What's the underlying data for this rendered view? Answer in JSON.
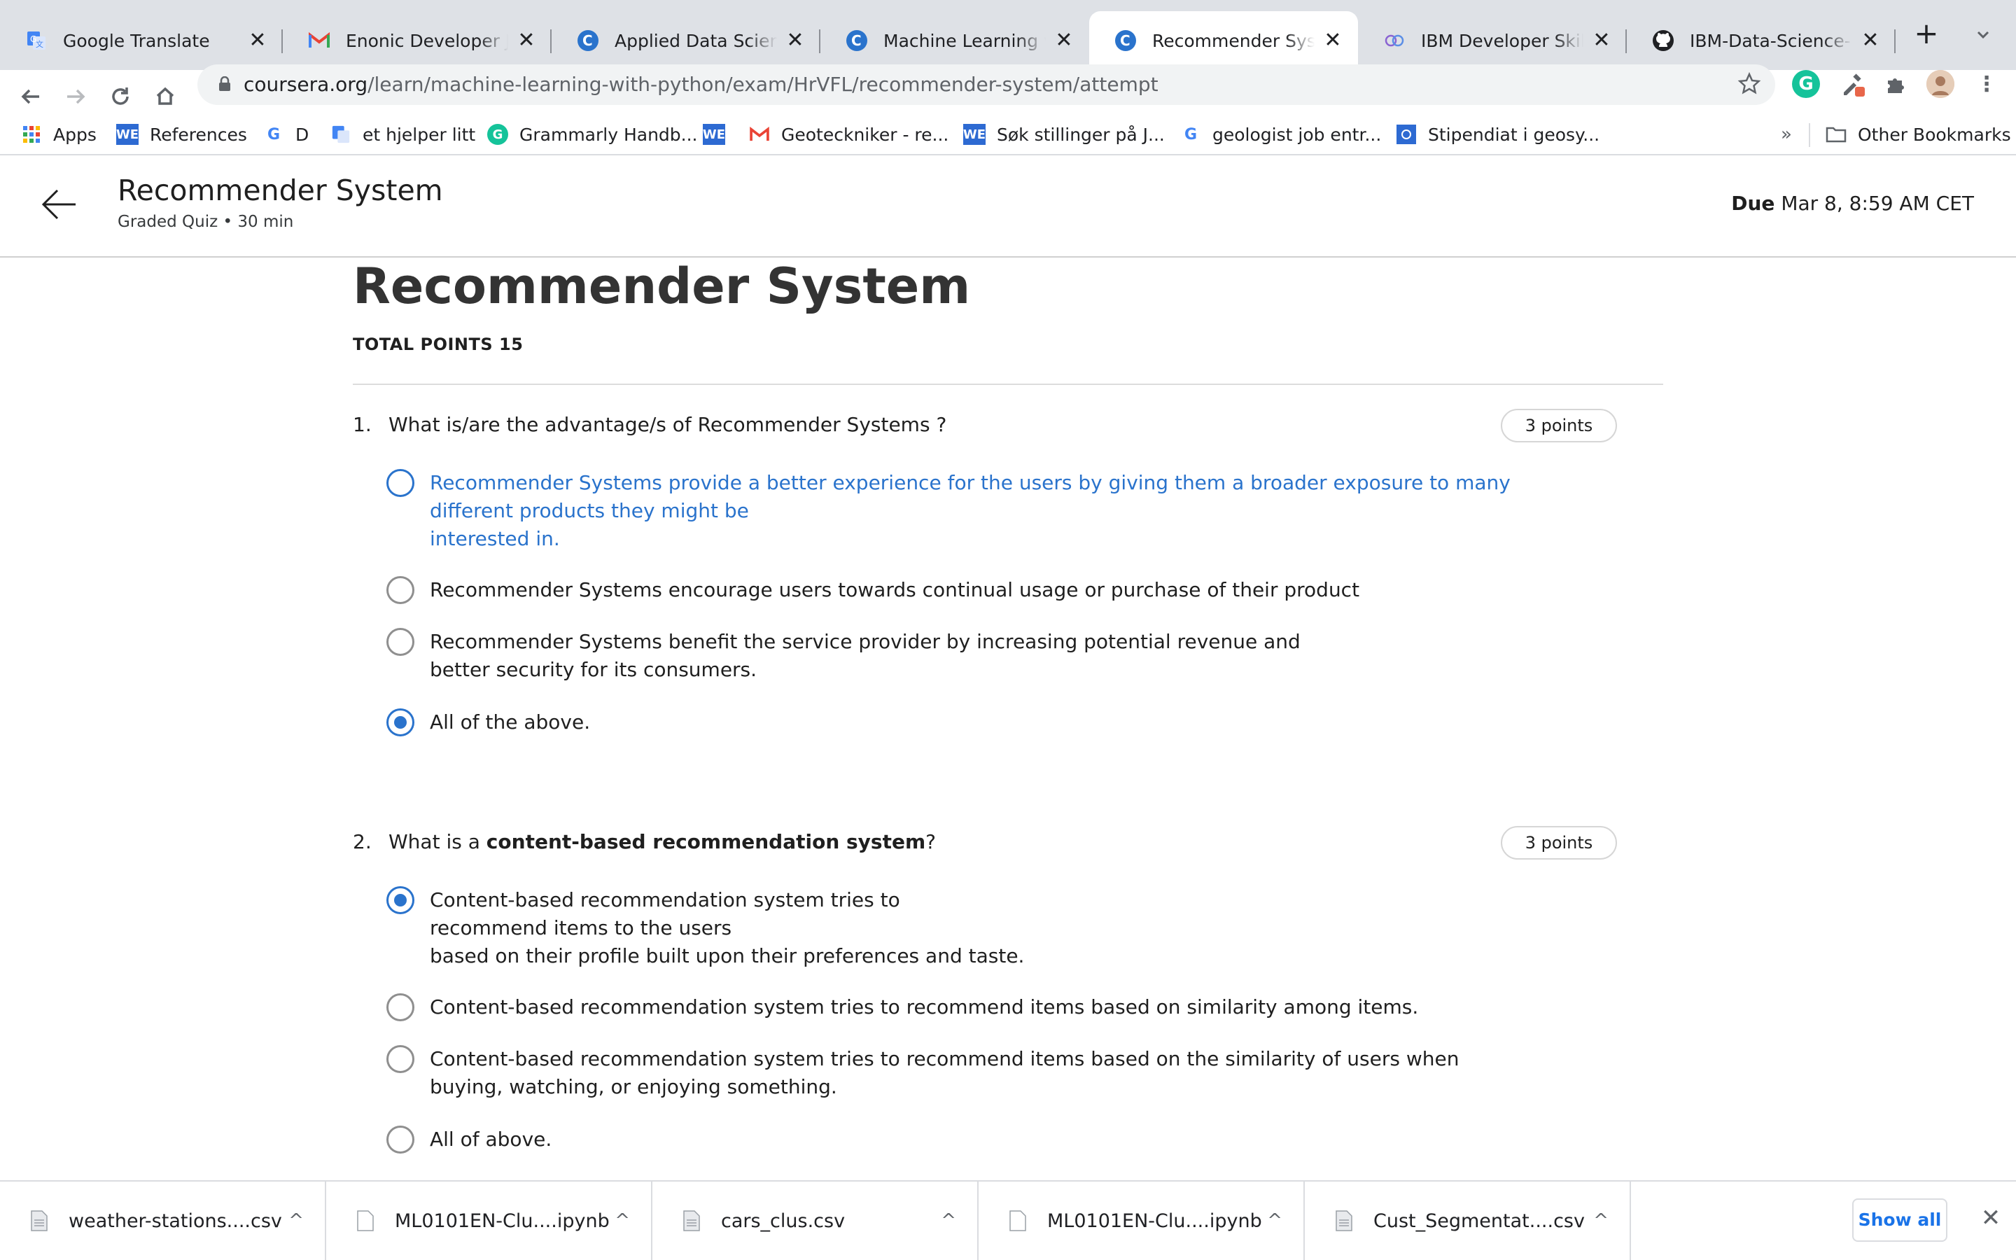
{
  "browser": {
    "tabs": [
      {
        "title": "Google Translate",
        "icon": "google-translate-icon"
      },
      {
        "title": "Enonic Developer Juice",
        "icon": "gmail-icon"
      },
      {
        "title": "Applied Data Science Capstone",
        "icon": "coursera-icon"
      },
      {
        "title": "Machine Learning with Python",
        "icon": "coursera-icon"
      },
      {
        "title": "Recommender System",
        "icon": "coursera-icon",
        "active": true
      },
      {
        "title": "IBM Developer Skills Network",
        "icon": "ibm-skills-icon"
      },
      {
        "title": "IBM-Data-Science-Professional",
        "icon": "github-icon"
      }
    ],
    "close_glyph": "✕",
    "new_tab_glyph": "+",
    "url_host": "coursera.org",
    "url_path": "/learn/machine-learning-with-python/exam/HrVFL/recommender-system/attempt",
    "bookmarks": [
      {
        "label": "Apps",
        "icon": "apps-grid-icon"
      },
      {
        "label": "References",
        "icon": "we-icon"
      },
      {
        "label": "D",
        "icon": "google-icon"
      },
      {
        "label": "et hjelper litt",
        "icon": "google-translate-icon"
      },
      {
        "label": "Grammarly Handb...",
        "icon": "grammarly-icon"
      },
      {
        "label": "",
        "icon": "we-icon"
      },
      {
        "label": "Geoteckniker - re...",
        "icon": "gmail-icon"
      },
      {
        "label": "Søk stillinger på J...",
        "icon": "we-icon"
      },
      {
        "label": "geologist job entr...",
        "icon": "google-icon"
      },
      {
        "label": "Stipendiat i geosy...",
        "icon": "blue-square-icon"
      }
    ],
    "bookmarks_overflow": "»",
    "other_bookmarks": "Other Bookmarks"
  },
  "header": {
    "title": "Recommender System",
    "subtitle": "Graded Quiz • 30 min",
    "due_label": "Due",
    "due_value": "Mar 8, 8:59 AM CET"
  },
  "quiz": {
    "title": "Recommender System",
    "total_points": "TOTAL POINTS 15",
    "questions": [
      {
        "number": "1.",
        "text": "What is/are the advantage/s of Recommender Systems ?",
        "points": "3 points",
        "options": [
          {
            "lines": [
              "Recommender Systems provide a better experience for the users by giving them a broader exposure to many",
              "different products they might be",
              "interested in."
            ],
            "state": "hover"
          },
          {
            "lines": [
              "Recommender Systems encourage users towards continual usage or purchase of their product"
            ],
            "state": "unchecked"
          },
          {
            "lines": [
              "Recommender Systems benefit the service provider by increasing potential revenue and",
              "better security for its consumers."
            ],
            "state": "unchecked"
          },
          {
            "lines": [
              "All of the above."
            ],
            "state": "checked"
          }
        ]
      },
      {
        "number": "2.",
        "text_before": "What is a ",
        "text_bold": "content-based recommendation system",
        "text_after": "?",
        "points": "3 points",
        "options": [
          {
            "lines": [
              "Content-based recommendation system tries to",
              "recommend items to the users",
              "based on their profile built upon their preferences and taste."
            ],
            "state": "checked"
          },
          {
            "lines": [
              "Content-based recommendation system tries to recommend items based on similarity among items."
            ],
            "state": "unchecked"
          },
          {
            "lines": [
              "Content-based recommendation system tries to recommend items based on the similarity of users when",
              "buying, watching, or enjoying something."
            ],
            "state": "unchecked"
          },
          {
            "lines": [
              "All of above."
            ],
            "state": "unchecked"
          }
        ]
      }
    ]
  },
  "downloads": {
    "items": [
      {
        "name": "weather-stations....csv"
      },
      {
        "name": "ML0101EN-Clu....ipynb"
      },
      {
        "name": "cars_clus.csv"
      },
      {
        "name": "ML0101EN-Clu....ipynb"
      },
      {
        "name": "Cust_Segmentat....csv"
      }
    ],
    "chevron_glyph": "^",
    "show_all": "Show all",
    "close_glyph": "✕"
  },
  "colors": {
    "accent": "#2a73cc",
    "link_blue": "#1a73e8"
  }
}
